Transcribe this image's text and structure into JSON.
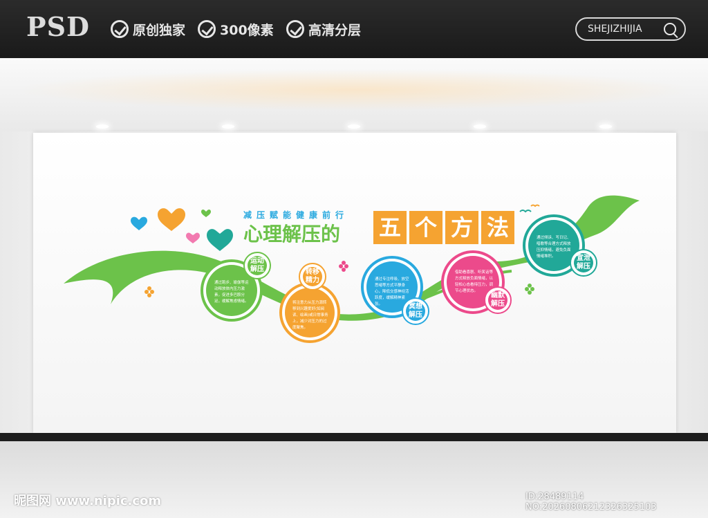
{
  "header": {
    "brand": "PSD",
    "features": [
      "原创独家",
      "300像素",
      "高清分层"
    ],
    "search_label": "SHEJIZHIJIA"
  },
  "banner": {
    "slogan": "减压赋能健康前行",
    "title_green": "心理解压的",
    "title_orange": [
      "五",
      "个",
      "方",
      "法"
    ]
  },
  "methods": [
    {
      "label": "运动解压",
      "text": "通过跑步、瑜伽等运动释放体内压力激素，促进多巴胺分泌，缓解焦虑情绪。",
      "color": "#6cc24a"
    },
    {
      "label": "转移精力",
      "text": "将注意力从压力源转移到兴趣爱好(如阅读、绘画)或日常事务上，减少对压力的过度聚焦。",
      "color": "#f5a331"
    },
    {
      "label": "冥想解压",
      "text": "通过专注呼吸、放空思绪等方式平静身心，降低交感神经活跃度，缓解精神紧张。",
      "color": "#29a9df"
    },
    {
      "label": "幽默解压",
      "text": "借助看喜剧、听笑话等方式释放负面情绪，以轻松心态看待压力，调节心理状态。",
      "color": "#ec4a8b"
    },
    {
      "label": "宣泄解压",
      "text": "通过倾诉、写日记、唱歌等合理方式释放压抑情绪，避免负面情绪堆积。",
      "color": "#21a898"
    }
  ],
  "colors": {
    "green": "#6cc24a",
    "orange": "#f5a331",
    "blue": "#29a9df",
    "pink": "#ec4a8b",
    "teal": "#21a898"
  },
  "watermark": {
    "left": "昵图网 www.nipic.com",
    "right": "ID:28489114 NO:20260806212326325103"
  }
}
